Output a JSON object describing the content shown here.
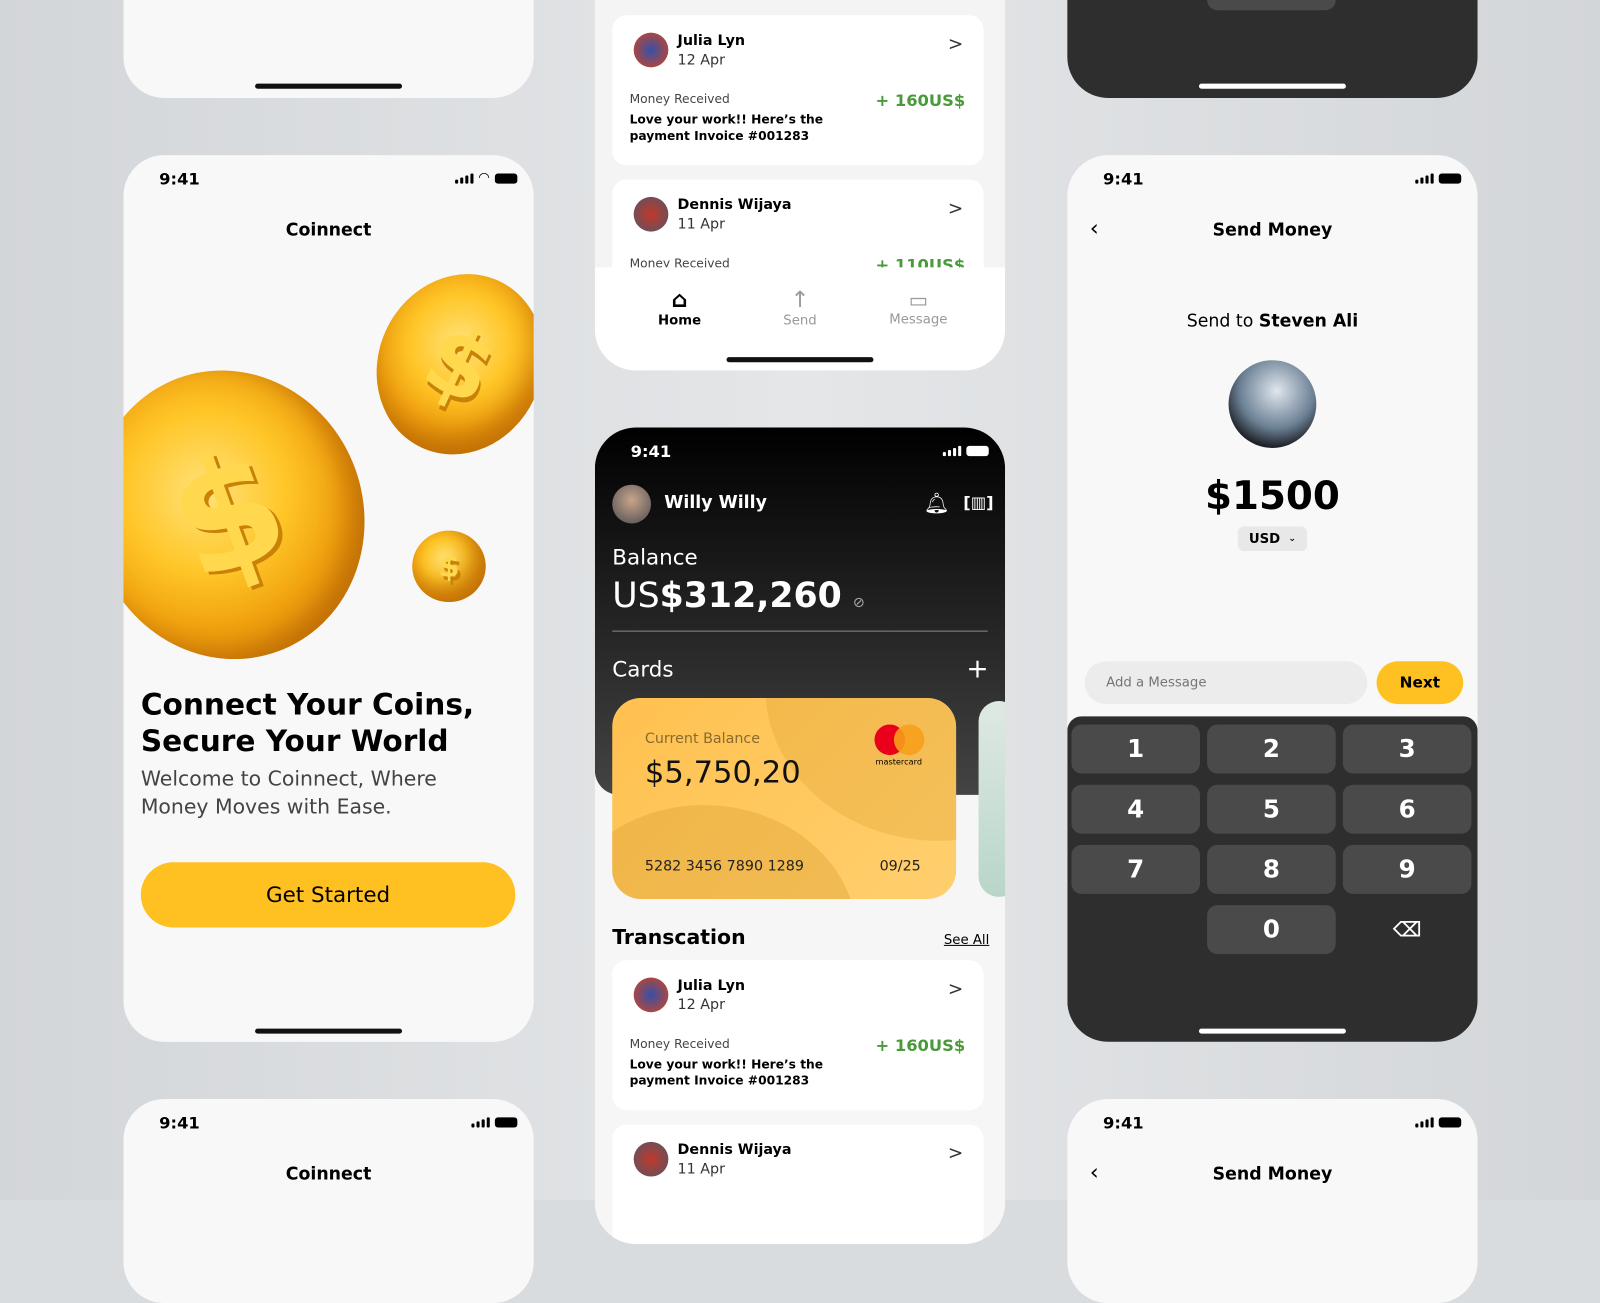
{
  "status": {
    "time": "9:41"
  },
  "onboarding": {
    "app_name": "Coinnect",
    "headline": "Connect Your Coins, Secure Your World",
    "subtitle": "Welcome to Coinnect, Where Money Moves with Ease.",
    "cta": "Get Started",
    "accent": "#FFC021"
  },
  "home": {
    "user": "Willy Willy",
    "balance_label": "Balance",
    "balance_prefix": "US",
    "balance_value": "$312,260",
    "cards_label": "Cards",
    "card": {
      "label": "Current Balance",
      "amount": "$5,750,20",
      "number": "5282 3456 7890 1289",
      "expiry": "09/25",
      "brand": "mastercard"
    },
    "transactions_title": "Transcation",
    "see_all": "See All",
    "transactions": [
      {
        "name": "Julia Lyn",
        "date": "12 Apr",
        "type": "Money Received",
        "message": "Love your work!! Here’s the payment Invoice #001283",
        "amount": "+ 160US$"
      },
      {
        "name": "Dennis Wijaya",
        "date": "11 Apr",
        "type": "Money Received",
        "amount": "+ 110US$"
      }
    ],
    "nav": [
      {
        "label": "Home",
        "icon": "home-icon"
      },
      {
        "label": "Send",
        "icon": "arrow-up-icon"
      },
      {
        "label": "Message",
        "icon": "message-icon"
      }
    ]
  },
  "send": {
    "title": "Send Money",
    "send_to_prefix": "Send to",
    "recipient": "Steven Ali",
    "amount": "$1500",
    "currency": "USD",
    "message_placeholder": "Add a Message",
    "next": "Next",
    "keys": [
      "1",
      "2",
      "3",
      "4",
      "5",
      "6",
      "7",
      "8",
      "9",
      "0"
    ]
  }
}
